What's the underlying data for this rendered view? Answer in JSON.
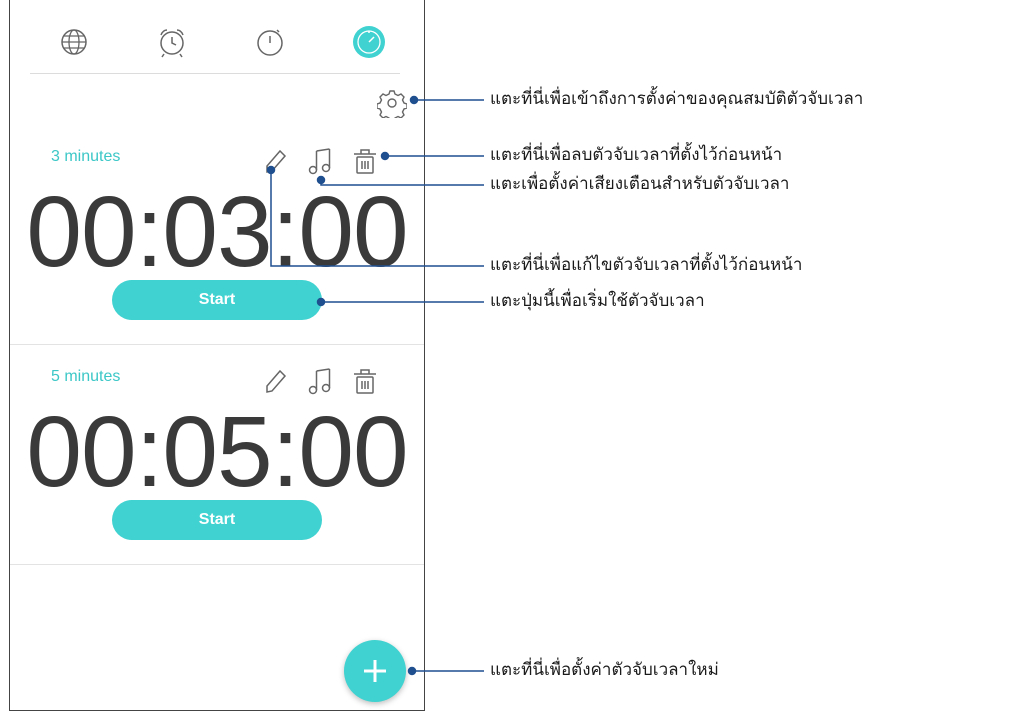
{
  "tabs": [
    {
      "icon": "globe-icon"
    },
    {
      "icon": "alarm-clock-icon"
    },
    {
      "icon": "stopwatch-icon"
    },
    {
      "icon": "timer-icon",
      "active": true
    }
  ],
  "colors": {
    "accent": "#3fd2d0",
    "label": "#3cc7c7",
    "callout_line": "#1f4f8f"
  },
  "timers": [
    {
      "label": "3 minutes",
      "time": "00:03:00",
      "start_label": "Start"
    },
    {
      "label": "5 minutes",
      "time": "00:05:00",
      "start_label": "Start"
    }
  ],
  "callouts": {
    "settings": "แตะที่นี่เพื่อเข้าถึงการตั้งค่าของคุณสมบัติตัวจับเวลา",
    "delete": "แตะที่นี่เพื่อลบตัวจับเวลาที่ตั้งไว้ก่อนหน้า",
    "sound": "แตะเพื่อตั้งค่าเสียงเตือนสำหรับตัวจับเวลา",
    "edit": "แตะที่นี่เพื่อแก้ไขตัวจับเวลาที่ตั้งไว้ก่อนหน้า",
    "start": "แตะปุ่มนี้เพื่อเริ่มใช้ตัวจับเวลา",
    "add": "แตะที่นี่เพื่อตั้งค่าตัวจับเวลาใหม่"
  }
}
